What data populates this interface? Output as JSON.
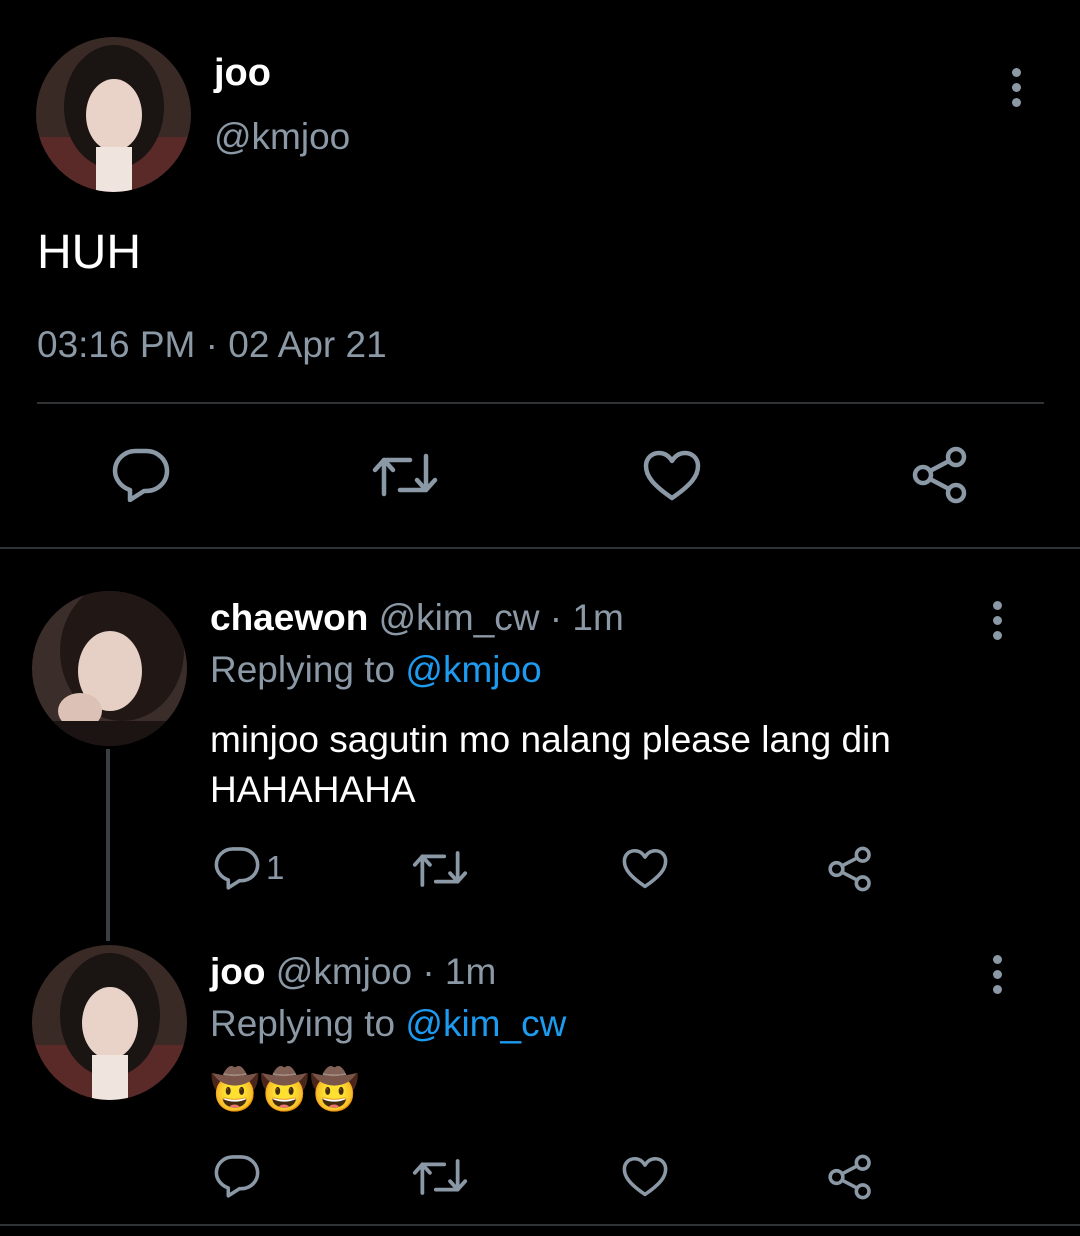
{
  "main_tweet": {
    "display_name": "joo",
    "handle": "@kmjoo",
    "text": "HUH",
    "timestamp": "03:16 PM · 02 Apr 21"
  },
  "replies": [
    {
      "display_name": "chaewon",
      "handle": "@kim_cw",
      "time": "· 1m",
      "replying_prefix": "Replying to",
      "replying_to": "@kmjoo",
      "text_line1": "minjoo sagutin mo nalang please lang din",
      "text_line2": "HAHAHAHA",
      "reply_count": "1"
    },
    {
      "display_name": "joo",
      "handle": "@kmjoo",
      "time": "· 1m",
      "replying_prefix": "Replying to",
      "replying_to": "@kim_cw",
      "text": "🤠🤠🤠"
    }
  ],
  "icons": {
    "reply": "reply-icon",
    "retweet": "retweet-icon",
    "like": "heart-icon",
    "share": "share-icon",
    "more": "more-options-icon"
  },
  "colors": {
    "background": "#000000",
    "text": "#e7e9ea",
    "secondary": "#8b98a5",
    "link": "#1d9bf0",
    "divider": "#2f3336"
  }
}
